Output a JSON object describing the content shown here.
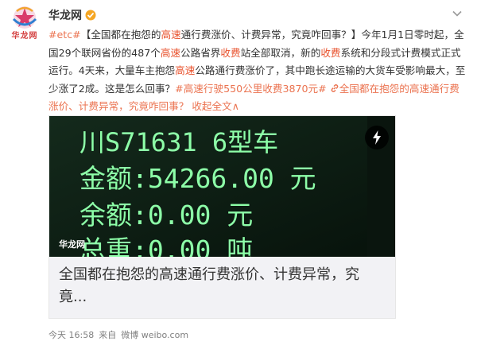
{
  "author": {
    "name": "华龙网",
    "avatar_label": "华龙网",
    "verified": true
  },
  "post": {
    "tag": "#etc#",
    "segments": [
      {
        "type": "plain",
        "text": "【全国都在抱怨的"
      },
      {
        "type": "hl",
        "text": "高速"
      },
      {
        "type": "plain",
        "text": "通行费涨价、计费异常，究竟咋回事？】今年1月1日零时起，全国29个联网省份的487个"
      },
      {
        "type": "hl",
        "text": "高速"
      },
      {
        "type": "plain",
        "text": "公路省界"
      },
      {
        "type": "hl",
        "text": "收费"
      },
      {
        "type": "plain",
        "text": "站全部取消，新的"
      },
      {
        "type": "hl",
        "text": "收费"
      },
      {
        "type": "plain",
        "text": "系统和分段式计费模式正式运行。4天来，大量车主抱怨"
      },
      {
        "type": "hl",
        "text": "高速"
      },
      {
        "type": "plain",
        "text": "公路通行费涨价了，其中跑长途运输的大货车受影响最大，至少涨了2成。这是怎么回事？"
      }
    ],
    "hashtag_link": "#高速行驶550公里收费3870元#",
    "article_link": "全国都在抱怨的高速通行费涨价、计费异常，究竟咋回事？",
    "collapse_label": "收起全文",
    "collapse_arrow": "∧"
  },
  "card": {
    "image_lines": [
      "川S71631 6型车",
      "金额:54266.00 元",
      "余额:0.00 元",
      "总重:0.00 吨"
    ],
    "watermark": "华龙网",
    "title": "全国都在抱怨的高速通行费涨价、计费异常，究竟..."
  },
  "meta": {
    "time": "今天 16:58",
    "source_prefix": "来自",
    "source": "微博 weibo.com"
  },
  "colors": {
    "accent": "#eb7350",
    "led_green": "#7dff9a",
    "verify_orange": "#f5a623"
  }
}
